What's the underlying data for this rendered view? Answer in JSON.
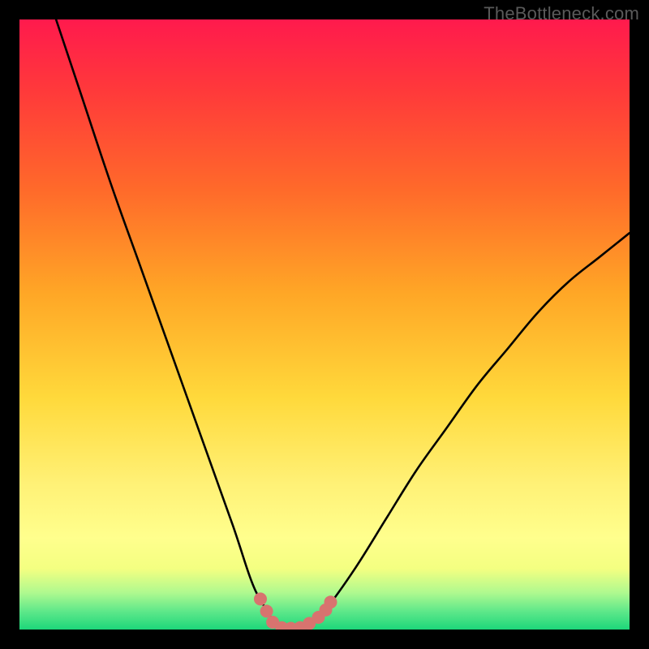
{
  "watermark": {
    "text": "TheBottleneck.com"
  },
  "chart_data": {
    "type": "line",
    "title": "",
    "xlabel": "",
    "ylabel": "",
    "xlim": [
      0,
      100
    ],
    "ylim": [
      0,
      100
    ],
    "series": [
      {
        "name": "bottleneck-curve",
        "x": [
          6,
          10,
          15,
          20,
          25,
          30,
          35,
          38,
          40,
          42,
          44,
          46,
          48,
          50,
          55,
          60,
          65,
          70,
          75,
          80,
          85,
          90,
          95,
          100
        ],
        "y": [
          100,
          88,
          73,
          59,
          45,
          31,
          17,
          8,
          4,
          1,
          0,
          0,
          1,
          3,
          10,
          18,
          26,
          33,
          40,
          46,
          52,
          57,
          61,
          65
        ]
      }
    ],
    "markers": {
      "name": "highlight-dots",
      "color": "#d8736f",
      "points": [
        {
          "x": 39.5,
          "y": 5
        },
        {
          "x": 40.5,
          "y": 3
        },
        {
          "x": 41.5,
          "y": 1.2
        },
        {
          "x": 43.0,
          "y": 0.3
        },
        {
          "x": 44.5,
          "y": 0.2
        },
        {
          "x": 46.0,
          "y": 0.3
        },
        {
          "x": 47.5,
          "y": 1.0
        },
        {
          "x": 49.0,
          "y": 2.0
        },
        {
          "x": 50.2,
          "y": 3.2
        },
        {
          "x": 51.0,
          "y": 4.5
        }
      ]
    },
    "background_gradient": {
      "top": "#ff1a4d",
      "bottom": "#1dd67a"
    }
  }
}
